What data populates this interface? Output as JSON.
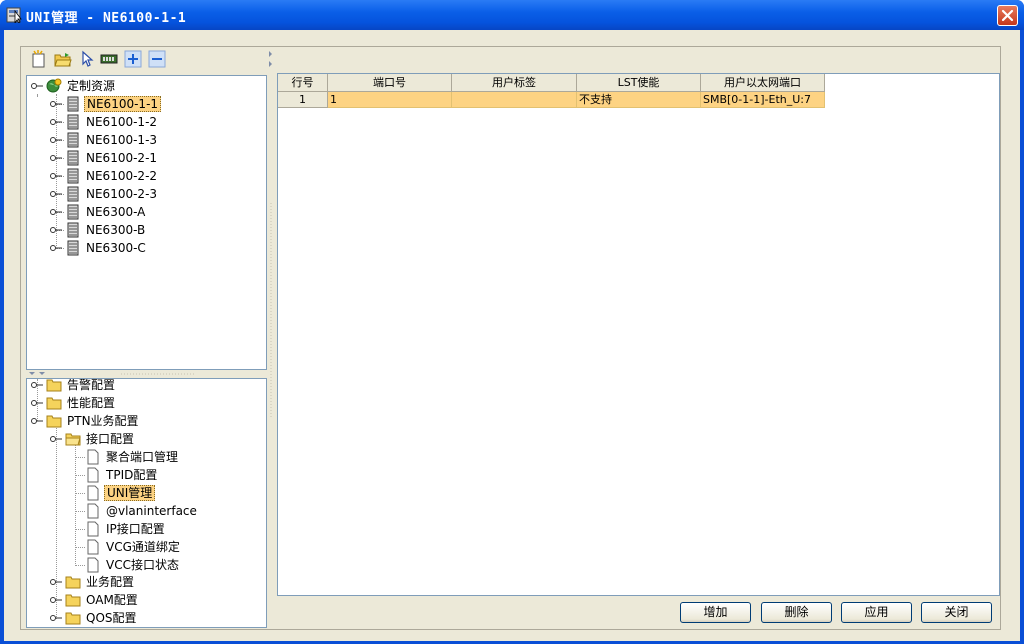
{
  "window": {
    "title": "UNI管理 - NE6100-1-1"
  },
  "resource_tree": {
    "root_label": "定制资源",
    "nodes": [
      "NE6100-1-1",
      "NE6100-1-2",
      "NE6100-1-3",
      "NE6100-2-1",
      "NE6100-2-2",
      "NE6100-2-3",
      "NE6300-A",
      "NE6300-B",
      "NE6300-C"
    ],
    "selected": "NE6100-1-1"
  },
  "function_tree": {
    "items": [
      "告警配置",
      "性能配置",
      "PTN业务配置",
      "接口配置",
      "聚合端口管理",
      "TPID配置",
      "UNI管理",
      "@vlaninterface",
      "IP接口配置",
      "VCG通道绑定",
      "VCC接口状态",
      "业务配置",
      "OAM配置",
      "QOS配置"
    ],
    "selected": "UNI管理"
  },
  "table": {
    "headers": [
      "行号",
      "端口号",
      "用户标签",
      "LST使能",
      "用户以太网端口"
    ],
    "rows": [
      [
        "1",
        "1",
        "",
        "不支持",
        "SMB[0-1-1]-Eth_U:7"
      ]
    ]
  },
  "buttons": {
    "add": "增加",
    "delete": "删除",
    "apply": "应用",
    "close": "关闭"
  },
  "icons": [
    "app-icon",
    "close-icon",
    "new-icon",
    "open-folder-icon",
    "pointer-icon",
    "board-icon",
    "expand-plus-icon",
    "collapse-minus-icon",
    "globe-icon",
    "ne-device-icon",
    "folder-icon",
    "document-icon"
  ],
  "colors": {
    "titlebar": "#0553dd",
    "selection": "#fdd383",
    "panel_bg": "#ece9d8"
  }
}
